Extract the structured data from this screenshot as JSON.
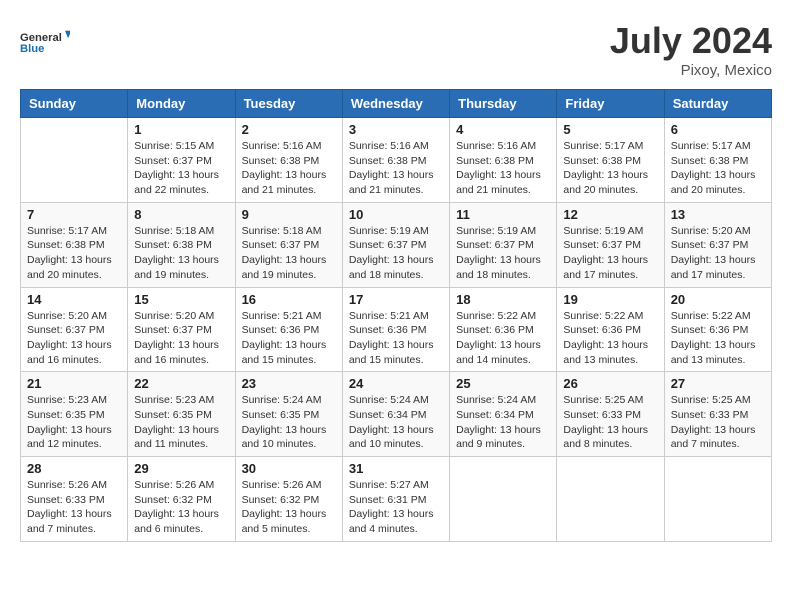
{
  "header": {
    "logo_line1": "General",
    "logo_line2": "Blue",
    "month_year": "July 2024",
    "location": "Pixoy, Mexico"
  },
  "weekdays": [
    "Sunday",
    "Monday",
    "Tuesday",
    "Wednesday",
    "Thursday",
    "Friday",
    "Saturday"
  ],
  "weeks": [
    [
      {
        "day": "",
        "info": ""
      },
      {
        "day": "1",
        "info": "Sunrise: 5:15 AM\nSunset: 6:37 PM\nDaylight: 13 hours\nand 22 minutes."
      },
      {
        "day": "2",
        "info": "Sunrise: 5:16 AM\nSunset: 6:38 PM\nDaylight: 13 hours\nand 21 minutes."
      },
      {
        "day": "3",
        "info": "Sunrise: 5:16 AM\nSunset: 6:38 PM\nDaylight: 13 hours\nand 21 minutes."
      },
      {
        "day": "4",
        "info": "Sunrise: 5:16 AM\nSunset: 6:38 PM\nDaylight: 13 hours\nand 21 minutes."
      },
      {
        "day": "5",
        "info": "Sunrise: 5:17 AM\nSunset: 6:38 PM\nDaylight: 13 hours\nand 20 minutes."
      },
      {
        "day": "6",
        "info": "Sunrise: 5:17 AM\nSunset: 6:38 PM\nDaylight: 13 hours\nand 20 minutes."
      }
    ],
    [
      {
        "day": "7",
        "info": "Sunrise: 5:17 AM\nSunset: 6:38 PM\nDaylight: 13 hours\nand 20 minutes."
      },
      {
        "day": "8",
        "info": "Sunrise: 5:18 AM\nSunset: 6:38 PM\nDaylight: 13 hours\nand 19 minutes."
      },
      {
        "day": "9",
        "info": "Sunrise: 5:18 AM\nSunset: 6:37 PM\nDaylight: 13 hours\nand 19 minutes."
      },
      {
        "day": "10",
        "info": "Sunrise: 5:19 AM\nSunset: 6:37 PM\nDaylight: 13 hours\nand 18 minutes."
      },
      {
        "day": "11",
        "info": "Sunrise: 5:19 AM\nSunset: 6:37 PM\nDaylight: 13 hours\nand 18 minutes."
      },
      {
        "day": "12",
        "info": "Sunrise: 5:19 AM\nSunset: 6:37 PM\nDaylight: 13 hours\nand 17 minutes."
      },
      {
        "day": "13",
        "info": "Sunrise: 5:20 AM\nSunset: 6:37 PM\nDaylight: 13 hours\nand 17 minutes."
      }
    ],
    [
      {
        "day": "14",
        "info": "Sunrise: 5:20 AM\nSunset: 6:37 PM\nDaylight: 13 hours\nand 16 minutes."
      },
      {
        "day": "15",
        "info": "Sunrise: 5:20 AM\nSunset: 6:37 PM\nDaylight: 13 hours\nand 16 minutes."
      },
      {
        "day": "16",
        "info": "Sunrise: 5:21 AM\nSunset: 6:36 PM\nDaylight: 13 hours\nand 15 minutes."
      },
      {
        "day": "17",
        "info": "Sunrise: 5:21 AM\nSunset: 6:36 PM\nDaylight: 13 hours\nand 15 minutes."
      },
      {
        "day": "18",
        "info": "Sunrise: 5:22 AM\nSunset: 6:36 PM\nDaylight: 13 hours\nand 14 minutes."
      },
      {
        "day": "19",
        "info": "Sunrise: 5:22 AM\nSunset: 6:36 PM\nDaylight: 13 hours\nand 13 minutes."
      },
      {
        "day": "20",
        "info": "Sunrise: 5:22 AM\nSunset: 6:36 PM\nDaylight: 13 hours\nand 13 minutes."
      }
    ],
    [
      {
        "day": "21",
        "info": "Sunrise: 5:23 AM\nSunset: 6:35 PM\nDaylight: 13 hours\nand 12 minutes."
      },
      {
        "day": "22",
        "info": "Sunrise: 5:23 AM\nSunset: 6:35 PM\nDaylight: 13 hours\nand 11 minutes."
      },
      {
        "day": "23",
        "info": "Sunrise: 5:24 AM\nSunset: 6:35 PM\nDaylight: 13 hours\nand 10 minutes."
      },
      {
        "day": "24",
        "info": "Sunrise: 5:24 AM\nSunset: 6:34 PM\nDaylight: 13 hours\nand 10 minutes."
      },
      {
        "day": "25",
        "info": "Sunrise: 5:24 AM\nSunset: 6:34 PM\nDaylight: 13 hours\nand 9 minutes."
      },
      {
        "day": "26",
        "info": "Sunrise: 5:25 AM\nSunset: 6:33 PM\nDaylight: 13 hours\nand 8 minutes."
      },
      {
        "day": "27",
        "info": "Sunrise: 5:25 AM\nSunset: 6:33 PM\nDaylight: 13 hours\nand 7 minutes."
      }
    ],
    [
      {
        "day": "28",
        "info": "Sunrise: 5:26 AM\nSunset: 6:33 PM\nDaylight: 13 hours\nand 7 minutes."
      },
      {
        "day": "29",
        "info": "Sunrise: 5:26 AM\nSunset: 6:32 PM\nDaylight: 13 hours\nand 6 minutes."
      },
      {
        "day": "30",
        "info": "Sunrise: 5:26 AM\nSunset: 6:32 PM\nDaylight: 13 hours\nand 5 minutes."
      },
      {
        "day": "31",
        "info": "Sunrise: 5:27 AM\nSunset: 6:31 PM\nDaylight: 13 hours\nand 4 minutes."
      },
      {
        "day": "",
        "info": ""
      },
      {
        "day": "",
        "info": ""
      },
      {
        "day": "",
        "info": ""
      }
    ]
  ]
}
